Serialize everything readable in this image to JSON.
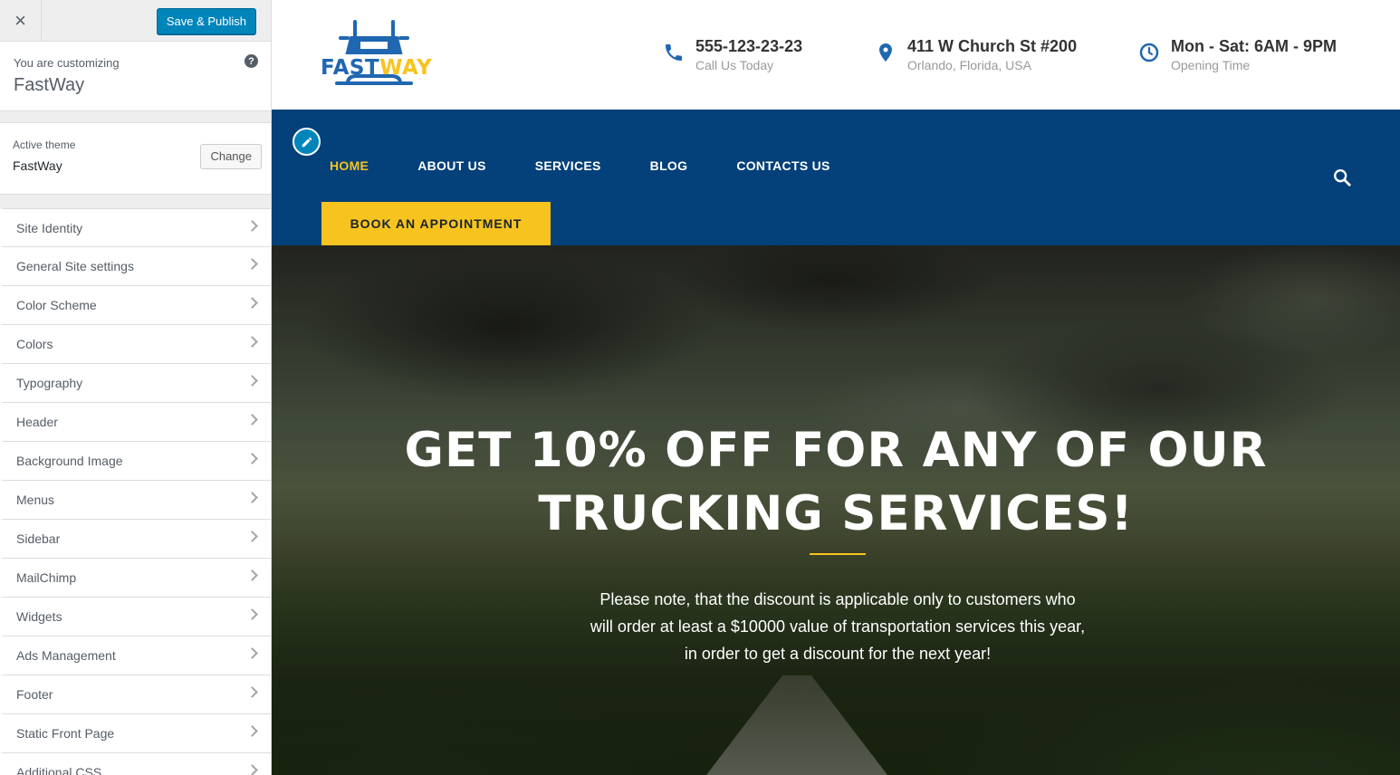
{
  "customizer": {
    "close_label": "×",
    "save_label": "Save & Publish",
    "customizing_label": "You are customizing",
    "site_name": "FastWay",
    "help_label": "?",
    "active_theme_label": "Active theme",
    "theme_name": "FastWay",
    "change_label": "Change",
    "sections": [
      {
        "label": "Site Identity"
      },
      {
        "label": "General Site settings"
      },
      {
        "label": "Color Scheme"
      },
      {
        "label": "Colors"
      },
      {
        "label": "Typography"
      },
      {
        "label": "Header"
      },
      {
        "label": "Background Image"
      },
      {
        "label": "Menus"
      },
      {
        "label": "Sidebar"
      },
      {
        "label": "MailChimp"
      },
      {
        "label": "Widgets"
      },
      {
        "label": "Ads Management"
      },
      {
        "label": "Footer"
      },
      {
        "label": "Static Front Page"
      },
      {
        "label": "Additional CSS"
      }
    ]
  },
  "site": {
    "logo": {
      "part1": "FAST",
      "part2": "WAY"
    },
    "contacts": [
      {
        "icon": "phone-icon",
        "title": "555-123-23-23",
        "subtitle": "Call Us Today"
      },
      {
        "icon": "map-marker-icon",
        "title": "411 W Church St #200",
        "subtitle": "Orlando, Florida, USA"
      },
      {
        "icon": "clock-icon",
        "title": "Mon - Sat: 6AM - 9PM",
        "subtitle": "Opening Time"
      }
    ],
    "nav": {
      "items": [
        "HOME",
        "ABOUT US",
        "SERVICES",
        "BLOG",
        "CONTACTS US"
      ],
      "active": "HOME",
      "cta": "BOOK AN APPOINTMENT"
    },
    "hero": {
      "title_line1": "GET 10% OFF FOR ANY OF OUR",
      "title_line2": "TRUCKING SERVICES!",
      "text": "Please note, that the discount is applicable only to customers who will order at least a $10000 value of transportation services this year, in order to get a discount for the next year!"
    },
    "colors": {
      "brand_blue": "#044079",
      "accent_yellow": "#f7c41f",
      "wp_blue": "#0085ba"
    }
  }
}
